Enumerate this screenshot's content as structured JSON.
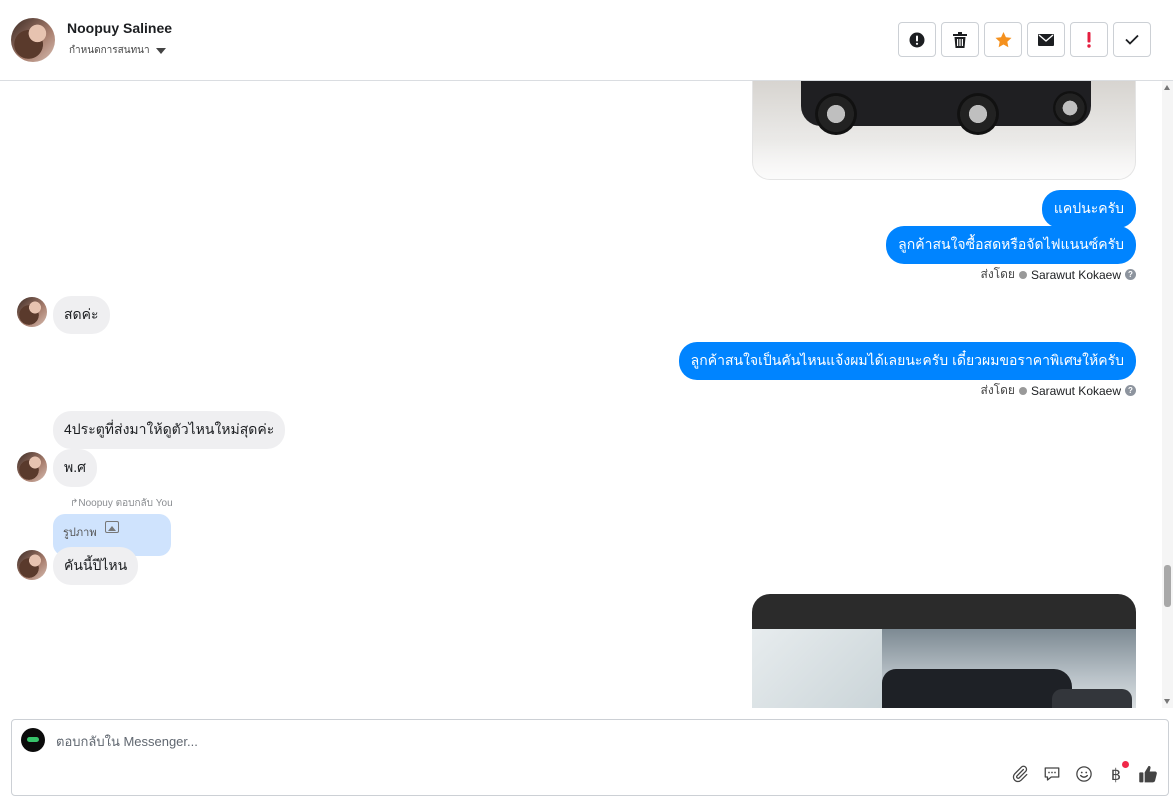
{
  "header": {
    "contact_name": "Noopuy Salinee",
    "subtitle": "กำหนดการสนทนา",
    "actions": [
      {
        "icon": "exclamation-circle-icon",
        "color": "#1c1e21"
      },
      {
        "icon": "trash-icon",
        "color": "#1c1e21"
      },
      {
        "icon": "star-icon",
        "color": "#f5911e"
      },
      {
        "icon": "mail-icon",
        "color": "#1c1e21"
      },
      {
        "icon": "exclamation-icon",
        "color": "#e41e3f"
      },
      {
        "icon": "check-icon",
        "color": "#1c1e21"
      }
    ]
  },
  "messages": {
    "out_1": "แคปนะครับ",
    "out_2": "ลูกค้าสนใจซื้อสดหรือจัดไฟแนนซ์ครับ",
    "sent_by_1": {
      "prefix": "ส่งโดย",
      "agent": "Sarawut Kokaew"
    },
    "in_1": "สดค่ะ",
    "out_3": "ลูกค้าสนใจเป็นคันไหนแจ้งผมได้เลยนะครับ เดี๋ยวผมขอราคาพิเศษให้ครับ",
    "sent_by_2": {
      "prefix": "ส่งโดย",
      "agent": "Sarawut Kokaew"
    },
    "in_2": "4ประตูที่ส่งมาให้ดูตัวไหนใหม่สุดค่ะ",
    "in_3": "พ.ศ",
    "reply_note": "Noopuy ตอบกลับ You",
    "reply_quote": "รูปภาพ",
    "in_4": "คันนี้ปีไหน"
  },
  "composer": {
    "placeholder": "ตอบกลับใน Messenger...",
    "tools": [
      "paperclip-icon",
      "chat-bubble-icon",
      "smiley-icon",
      "baht-icon",
      "thumbs-up-icon"
    ],
    "baht_symbol": "฿"
  },
  "colors": {
    "outgoing_bubble": "#0084ff",
    "incoming_bubble": "#efeff1",
    "reply_quote_bg": "#cfe3fd",
    "notification_dot": "#f02849"
  }
}
